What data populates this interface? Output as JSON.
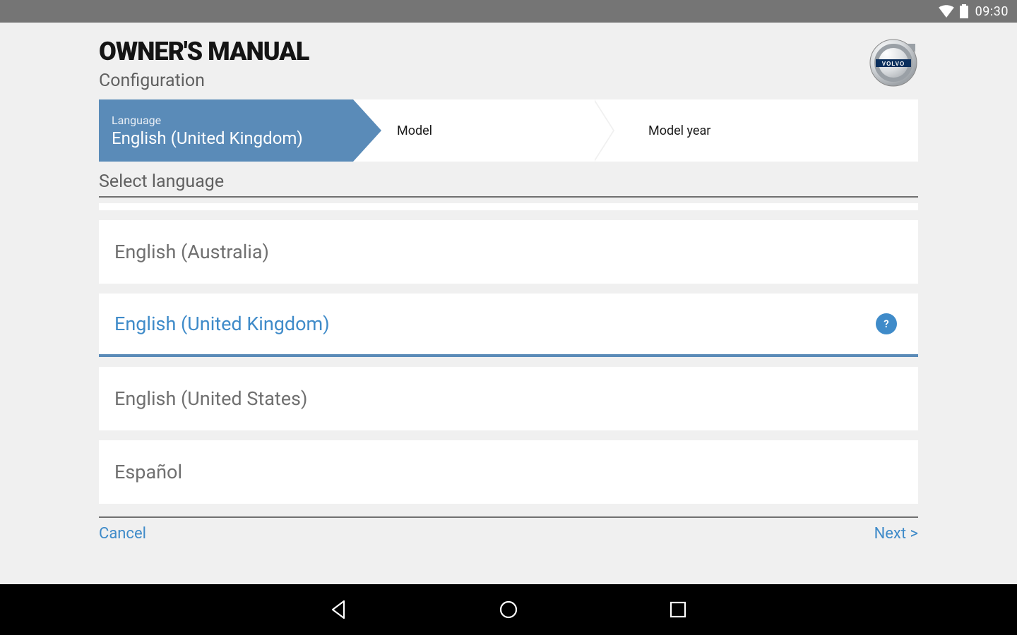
{
  "status": {
    "time": "09:30"
  },
  "header": {
    "title": "OWNER'S MANUAL",
    "subtitle": "Configuration"
  },
  "stepper": {
    "step1": {
      "label": "Language",
      "value": "English (United Kingdom)"
    },
    "step2": {
      "label": "Model"
    },
    "step3": {
      "label": "Model year"
    }
  },
  "section": {
    "title": "Select language"
  },
  "languages": {
    "item0": "English (Australia)",
    "item1": "English (United Kingdom)",
    "item2": "English (United States)",
    "item3": "Español"
  },
  "help_badge": "?",
  "footer": {
    "cancel": "Cancel",
    "next": "Next >"
  },
  "colors": {
    "accent": "#3f8bc9",
    "step_bg": "#5a8bb8"
  },
  "brand": "VOLVO"
}
